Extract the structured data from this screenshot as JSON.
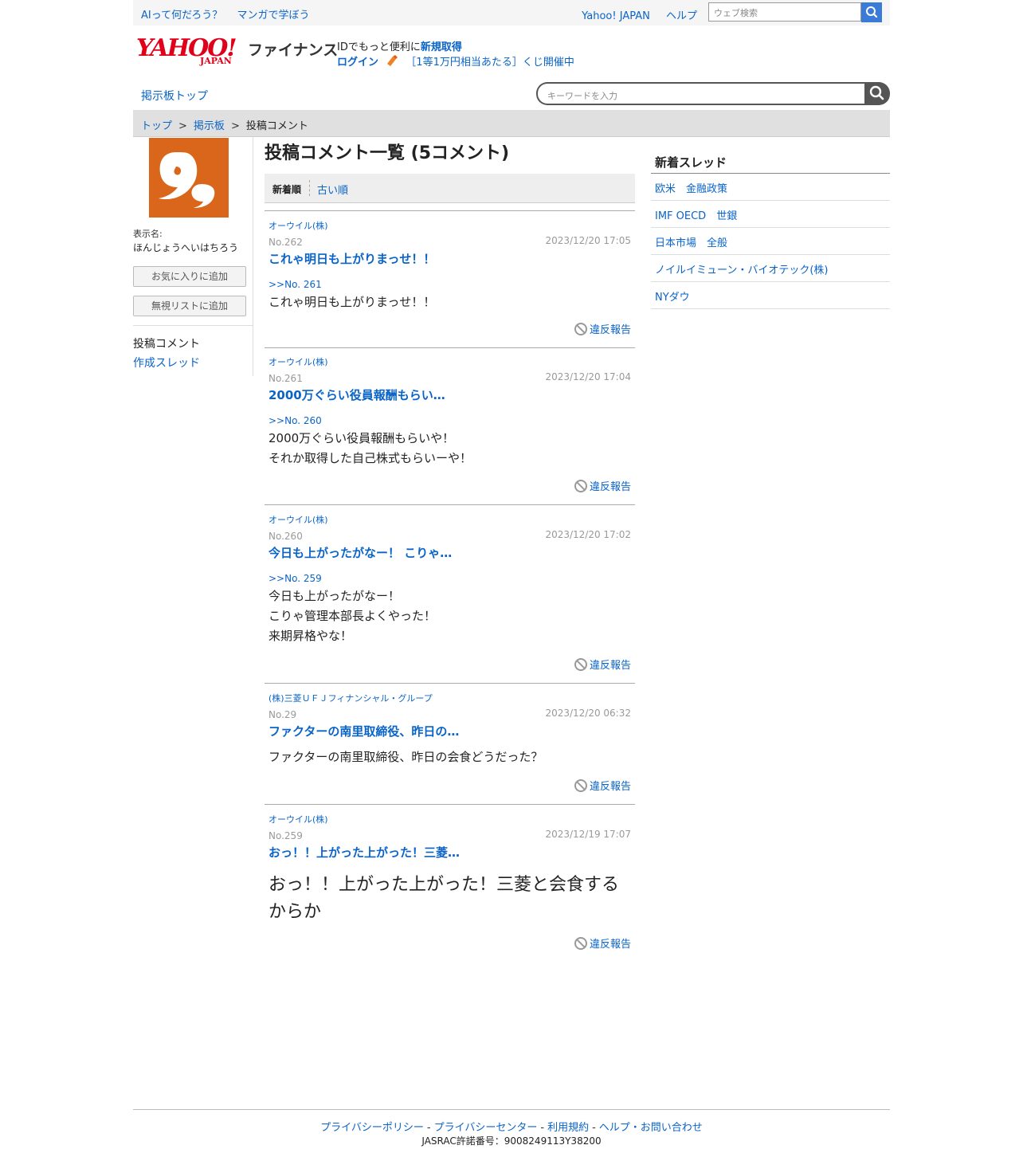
{
  "topbar": {
    "links": [
      "AIって何だろう？",
      "マンガで学ぼう"
    ],
    "right_links": [
      "Yahoo! JAPAN",
      "ヘルプ"
    ],
    "search_placeholder": "ウェブ検索"
  },
  "header": {
    "logo_text": "YAHOO!",
    "logo_sub": "JAPAN",
    "brand": "ファイナンス",
    "id_text": "IDでもっと便利に",
    "register": "新規取得",
    "login": "ログイン",
    "lottery": "［1等1万円相当あたる］くじ開催中"
  },
  "subnav": {
    "bbs_top": "掲示板トップ",
    "keyword_placeholder": "キーワードを入力"
  },
  "breadcrumb": [
    "トップ",
    "掲示板",
    "投稿コメント"
  ],
  "breadcrumb_sep": ">",
  "profile": {
    "display_name_label": "表示名:",
    "display_name": "ほんじょうへいはちろう",
    "favorite_button": "お気に入りに追加",
    "ignore_button": "無視リストに追加",
    "nav_posts": "投稿コメント",
    "nav_threads": "作成スレッド"
  },
  "main": {
    "title": "投稿コメント一覧 (5コメント)",
    "sort_new": "新着順",
    "sort_old": "古い順",
    "report_label": "違反報告",
    "posts": [
      {
        "company": "オーウイル(株)",
        "no": "No.262",
        "time": "2023/12/20 17:05",
        "title": "これゃ明日も上がりまっせ！！",
        "reply": ">>No. 261",
        "body": [
          "これゃ明日も上がりまっせ！！"
        ]
      },
      {
        "company": "オーウイル(株)",
        "no": "No.261",
        "time": "2023/12/20 17:04",
        "title": "2000万ぐらい役員報酬もらい…",
        "reply": ">>No. 260",
        "body": [
          "2000万ぐらい役員報酬もらいや！",
          "それか取得した自己株式もらいーや！"
        ]
      },
      {
        "company": "オーウイル(株)",
        "no": "No.260",
        "time": "2023/12/20 17:02",
        "title": "今日も上がったがなー！ こりゃ…",
        "reply": ">>No. 259",
        "body": [
          "今日も上がったがなー！",
          "こりゃ管理本部長よくやった！",
          "来期昇格やな！"
        ]
      },
      {
        "company": "(株)三菱ＵＦＪフィナンシャル・グループ",
        "no": "No.29",
        "time": "2023/12/20 06:32",
        "title": "ファクターの南里取締役、昨日の…",
        "reply": "",
        "body": [
          "ファクターの南里取締役、昨日の会食どうだった？"
        ]
      },
      {
        "company": "オーウイル(株)",
        "no": "No.259",
        "time": "2023/12/19 17:07",
        "title": "おっ！！上がった上がった！三菱…",
        "reply": "",
        "body": [
          "おっ！！上がった上がった！三菱と会食する",
          "からか"
        ]
      }
    ]
  },
  "sidebar": {
    "title": "新着スレッド",
    "items": [
      "欧米　金融政策",
      "IMF OECD　世銀",
      "日本市場　全般",
      "ノイルイミューン・バイオテック(株)",
      "NYダウ"
    ]
  },
  "footer": {
    "links": [
      "プライバシーポリシー",
      "プライバシーセンター",
      "利用規約",
      "ヘルプ・お問い合わせ"
    ],
    "sep": "-",
    "jasrac": "JASRAC許諾番号：9008249113Y38200"
  }
}
